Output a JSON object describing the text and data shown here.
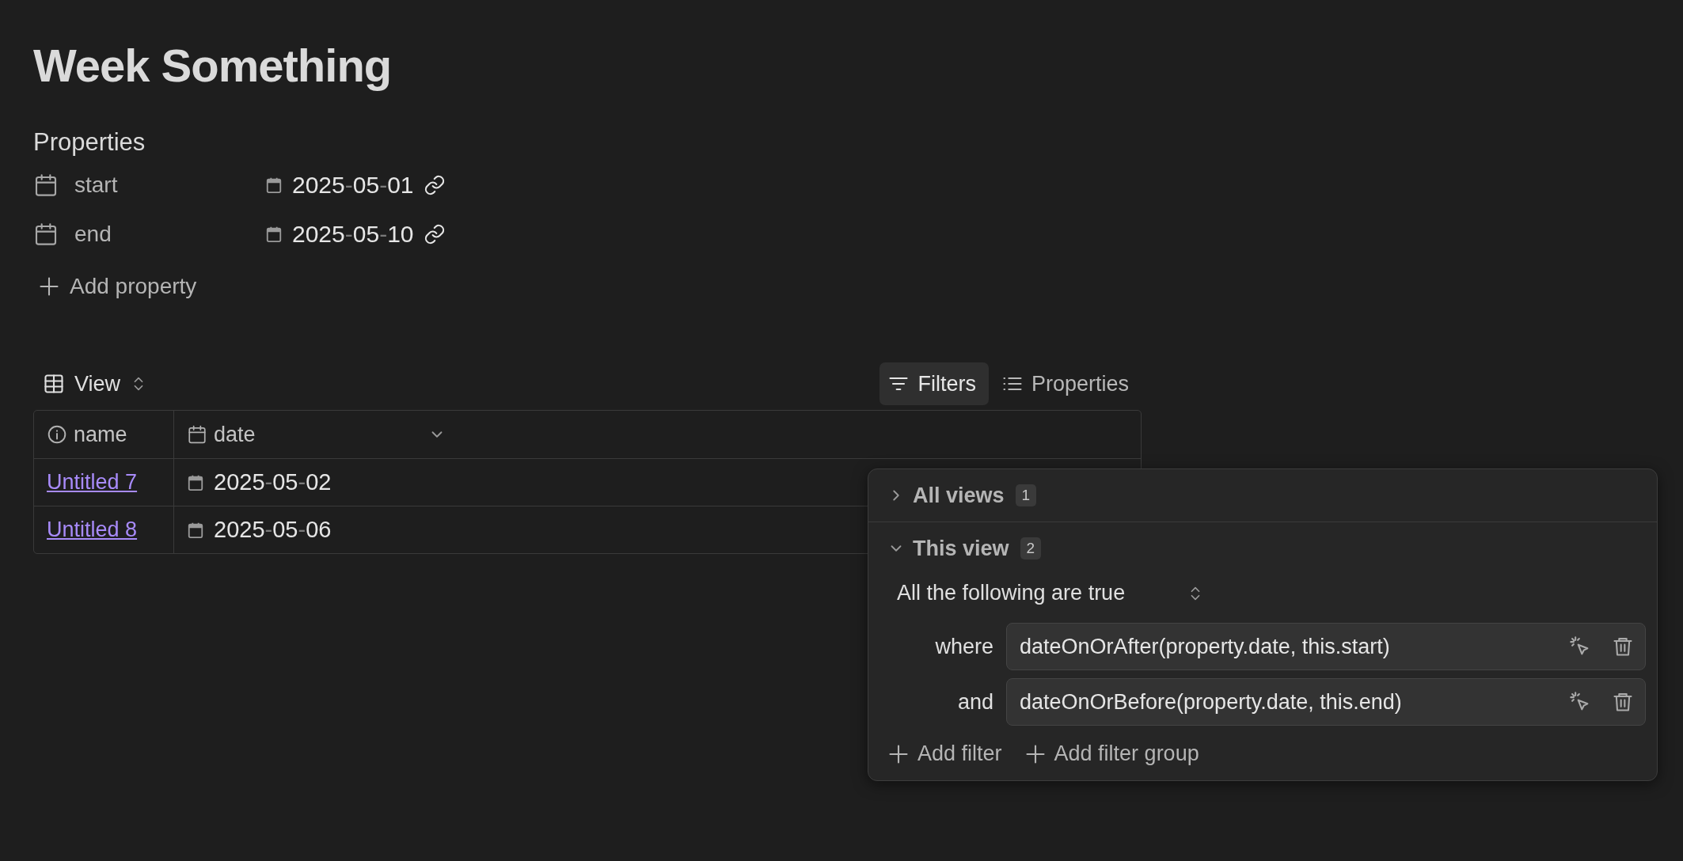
{
  "page": {
    "title": "Week Something"
  },
  "properties": {
    "heading": "Properties",
    "items": [
      {
        "name": "start",
        "value": "2025-05-01"
      },
      {
        "name": "end",
        "value": "2025-05-10"
      }
    ],
    "add_label": "Add property"
  },
  "toolbar": {
    "view_label": "View",
    "buttons": [
      {
        "label": "Filters",
        "kind": "filter",
        "selected": true
      },
      {
        "label": "Properties",
        "kind": "list",
        "selected": false
      }
    ]
  },
  "table": {
    "columns": [
      {
        "label": "name",
        "kind": "info"
      },
      {
        "label": "date",
        "kind": "calendar"
      }
    ],
    "rows": [
      {
        "name": "Untitled 7",
        "date": "2025-05-02"
      },
      {
        "name": "Untitled 8",
        "date": "2025-05-06"
      }
    ]
  },
  "filters_popup": {
    "sections": [
      {
        "label": "All views",
        "count": "1",
        "expanded": false
      },
      {
        "label": "This view",
        "count": "2",
        "expanded": true
      }
    ],
    "mode": "All the following are true",
    "filters": [
      {
        "joiner": "where",
        "expression": "dateOnOrAfter(property.date, this.start)"
      },
      {
        "joiner": "and",
        "expression": "dateOnOrBefore(property.date, this.end)"
      }
    ],
    "actions": [
      "Add filter",
      "Add filter group"
    ]
  }
}
